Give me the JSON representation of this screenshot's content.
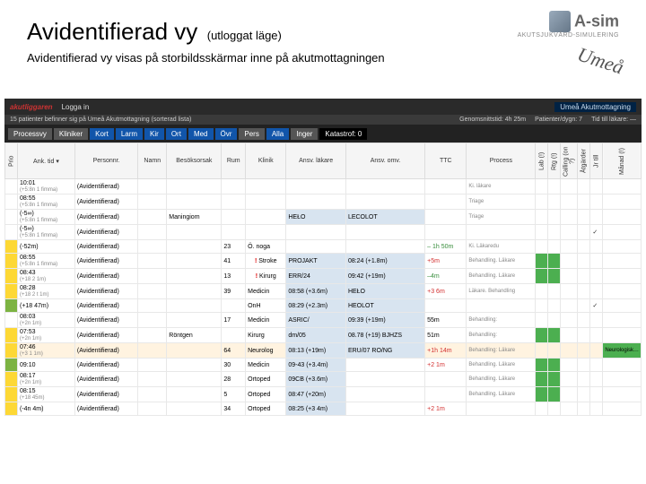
{
  "slide": {
    "title": "Avidentifierad vy",
    "subtitle": "(utloggat läge)",
    "description": "Avidentifierad vy visas på storbildsskärmar inne på akutmottagningen"
  },
  "logo": {
    "main": "A-sim",
    "sub": "AKUTSJUKVÅRD-SIMULERING"
  },
  "badge": "Umeå",
  "app": {
    "topbar": {
      "brand": "akutliggaren",
      "login": "Logga in",
      "location": "Umeå Akutmottagning"
    },
    "info": {
      "left": "15 patienter befinner sig på Umeå Akutmottagning (sorterad lista)",
      "gs_label": "Genomsnittstid:",
      "gs_val": "4h 25m",
      "pu_label": "Patienter/dygn:",
      "pu_val": "7",
      "tid_label": "Tid till läkare:",
      "tid_val": "—"
    },
    "tabs": [
      "Processvy",
      "Kliniker",
      "Kort",
      "Larm",
      "Kir",
      "Ort",
      "Med",
      "Övr",
      "Pers",
      "Alla",
      "Inger"
    ],
    "kategori": "Katastrof: 0",
    "columns": {
      "prio": "Prio",
      "ank": "Ank. tid ▾",
      "pnr": "Personnr.",
      "namn": "Namn",
      "orsak": "Besöksorsak",
      "rum": "Rum",
      "klinik": "Klinik",
      "ansvlak": "Ansv. läkare",
      "ansvom": "Ansv. omv.",
      "ttc": "TTC",
      "process": "Process",
      "lab": "Lab (!)",
      "rtg": "Rtg (!)",
      "calling": "Calling (on ?)",
      "atg": "Åtgärder",
      "jr": "Jr till",
      "manad": "Månad (!)"
    },
    "rows": [
      {
        "prio": "",
        "ank": "10:01",
        "vt": "(+5:8n 1 fimma)",
        "pnr": "(Avidentifierad)",
        "namn": "",
        "orsak": "",
        "rum": "",
        "klinik": "",
        "lak": "",
        "omv": "",
        "ttc": "",
        "proc": "Ki. läkare",
        "alert": false,
        "hi": false,
        "chk": false
      },
      {
        "prio": "",
        "ank": "08:55",
        "vt": "(+5:8n 1 fimma)",
        "pnr": "(Avidentifierad)",
        "namn": "",
        "orsak": "",
        "rum": "",
        "klinik": "",
        "lak": "",
        "omv": "",
        "ttc": "",
        "proc": "Triage",
        "alert": false,
        "hi": false,
        "chk": false
      },
      {
        "prio": "",
        "ank": "(-5∞)",
        "vt": "(+5:8n 1 fimma)",
        "pnr": "(Avidentifierad)",
        "namn": "",
        "orsak": "Maningiom",
        "rum": "",
        "klinik": "",
        "lak": "HEŁO",
        "omv": "LECOLOT",
        "ttc": "",
        "proc": "Triage",
        "alert": false,
        "hi": false,
        "chk": false
      },
      {
        "prio": "",
        "ank": "(-5∞)",
        "vt": "(+5:8n 1 fimma)",
        "pnr": "(Avidentifierad)",
        "namn": "",
        "orsak": "",
        "rum": "",
        "klinik": "",
        "lak": "",
        "omv": "",
        "ttc": "",
        "proc": "",
        "alert": false,
        "hi": false,
        "chk": true
      },
      {
        "prio": "3",
        "ank": "(-52m)",
        "vt": "",
        "pnr": "(Avidentifierad)",
        "namn": "",
        "orsak": "",
        "rum": "23",
        "klinik": "Ö. noga",
        "lak": "",
        "omv": "",
        "ttc": "– 1h 50m",
        "proc": "Ki. Läkaredu",
        "alert": false,
        "hi": false,
        "chk": false
      },
      {
        "prio": "3",
        "ank": "08:55",
        "vt": "(+5:8n 1 fimma)",
        "pnr": "(Avidentifierad)",
        "namn": "",
        "orsak": "",
        "rum": "41",
        "klinik": "Stroke",
        "lak": "PROJAKT",
        "omv": "08:24 (+1.8m)",
        "ttc": "+5m",
        "proc": "Behandling. Läkare",
        "alert": true,
        "hi": false,
        "chk": false,
        "mark": true
      },
      {
        "prio": "3",
        "ank": "08:43",
        "vt": "(+18 2 1m)",
        "pnr": "(Avidentifierad)",
        "namn": "",
        "orsak": "",
        "rum": "13",
        "klinik": "Kirurg",
        "lak": "ERR/24",
        "omv": "09:42 (+19m)",
        "ttc": "–4m",
        "proc": "Behandling. Läkare",
        "alert": true,
        "hi": false,
        "chk": false,
        "mark": true
      },
      {
        "prio": "3",
        "ank": "08:28",
        "vt": "(+18 2 t 1m)",
        "pnr": "(Avidentifierad)",
        "namn": "",
        "orsak": "",
        "rum": "39",
        "klinik": "Medicin",
        "lak": "08:58 (+3.6m)",
        "omv": "HEŁO",
        "ttc": "+3 6m",
        "proc": "Läkare. Behandling",
        "alert": false,
        "hi": false,
        "chk": false
      },
      {
        "prio": "4",
        "ank": "(+18 47m)",
        "vt": "",
        "pnr": "(Avidentifierad)",
        "namn": "",
        "orsak": "",
        "rum": "",
        "klinik": "OnH",
        "lak": "08:29 (+2.3m)",
        "omv": "HEOLOT",
        "ttc": "",
        "proc": "",
        "alert": false,
        "hi": false,
        "chk": true
      },
      {
        "prio": "",
        "ank": "08:03",
        "vt": "(+2n 1m)",
        "pnr": "(Avidentifierad)",
        "namn": "",
        "orsak": "",
        "rum": "17",
        "klinik": "Medicin",
        "lak": "ASRIC/",
        "omv": "09:39 (+19m)",
        "ttc": "55m",
        "proc": "Behandling:",
        "alert": false,
        "hi": false,
        "chk": false
      },
      {
        "prio": "3",
        "ank": "07:53",
        "vt": "(+2n 1m)",
        "pnr": "(Avidentifierad)",
        "namn": "",
        "orsak": "Röntgen",
        "rum": "",
        "klinik": "Kirurg",
        "lak": "dm/05",
        "omv": "08.78 (+19) BJHZS",
        "ttc": "51m",
        "proc": "Behandling:",
        "alert": false,
        "hi": false,
        "chk": false,
        "mark": true
      },
      {
        "prio": "3",
        "ank": "07:46",
        "vt": "(+3 1 1m)",
        "pnr": "(Avidentifierad)",
        "namn": "",
        "orsak": "",
        "rum": "64",
        "klinik": "Neurolog",
        "lak": "08:13 (+19m)",
        "omv": "ERU/07 RO/NG",
        "ttc": "+1h 14m",
        "proc": "Behandling: Läkare",
        "alert": false,
        "hi": true,
        "chk": false,
        "neuro": true
      },
      {
        "prio": "4",
        "ank": "09:10",
        "vt": "",
        "pnr": "(Avidentifierad)",
        "namn": "",
        "orsak": "",
        "rum": "30",
        "klinik": "Medicin",
        "lak": "09-43 (+3.4m)",
        "omv": "",
        "ttc": "+2 1m",
        "proc": "Behandling. Läkare",
        "alert": false,
        "hi": false,
        "chk": false,
        "mark": true
      },
      {
        "prio": "3",
        "ank": "08:17",
        "vt": "(+2n 1m)",
        "pnr": "(Avidentifierad)",
        "namn": "",
        "orsak": "",
        "rum": "28",
        "klinik": "Ortoped",
        "lak": "09CB (+3.6m)",
        "omv": "",
        "ttc": "",
        "proc": "Behandling. Läkare",
        "alert": false,
        "hi": false,
        "chk": false,
        "mark": true
      },
      {
        "prio": "3",
        "ank": "08:15",
        "vt": "(+18 45m)",
        "pnr": "(Avidentifierad)",
        "namn": "",
        "orsak": "",
        "rum": "5",
        "klinik": "Ortoped",
        "lak": "08:47 (+20m)",
        "omv": "",
        "ttc": "",
        "proc": "Behandling. Läkare",
        "alert": false,
        "hi": false,
        "chk": false,
        "mark": true
      },
      {
        "prio": "3",
        "ank": "(-4n 4m)",
        "vt": "",
        "pnr": "(Avidentifierad)",
        "namn": "",
        "orsak": "",
        "rum": "34",
        "klinik": "Ortoped",
        "lak": "08:25 (+3 4m)",
        "omv": "",
        "ttc": "+2 1m",
        "proc": "",
        "alert": false,
        "hi": false,
        "chk": false
      }
    ]
  }
}
